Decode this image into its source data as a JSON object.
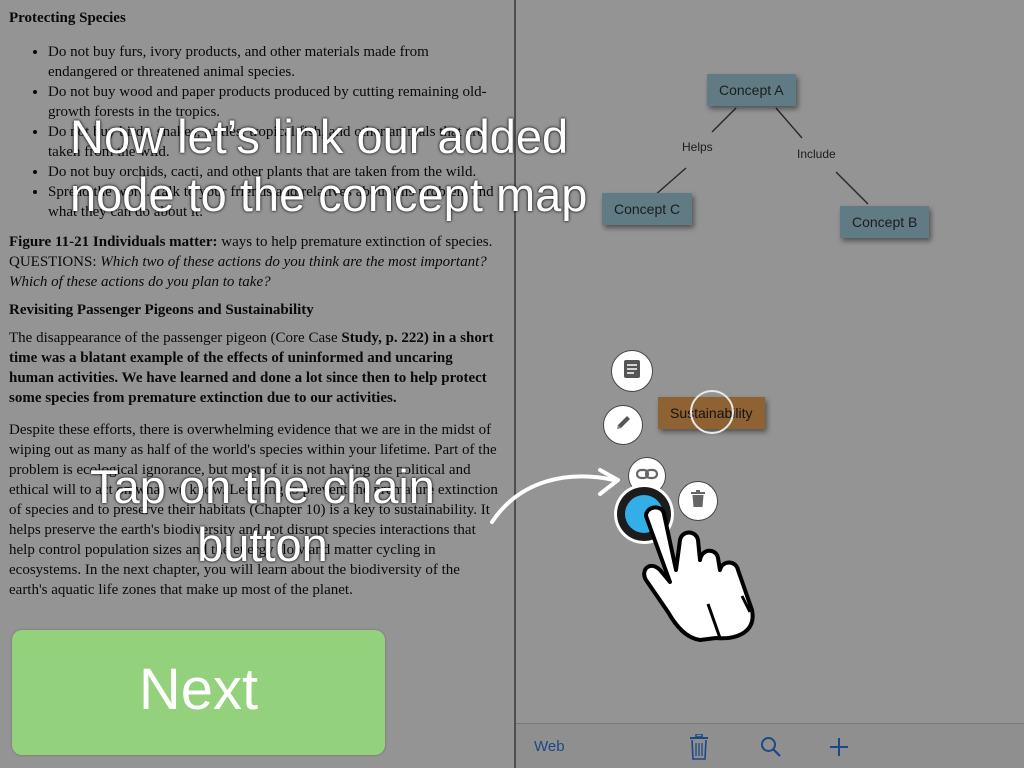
{
  "document": {
    "heading1": "Protecting Species",
    "bullets": [
      "Do not buy furs, ivory products, and other materials made from endangered or threatened animal species.",
      "Do not buy wood and paper products produced by cutting remaining old-growth forests in the tropics.",
      "Do not buy birds, snakes, turtles, tropical fish, and other animals that are taken from the wild.",
      "Do not buy orchids, cacti, and other plants that are taken from the wild.",
      "Spread the word. Talk to your friends and relatives about this problem and what they can do about it."
    ],
    "figure_label": "Figure 11-21 Individuals matter:",
    "figure_text": " ways to help premature extinction of species. QUESTIONS: ",
    "figure_questions": "Which two of these actions do you think are the most important? Which of these actions do you plan to take?",
    "heading2": "Revisiting Passenger Pigeons and Sustainability",
    "para1_start": "The disappearance of the passenger pigeon (Core Case ",
    "para1_bold": "Study, p. 222) in a short time was a blatant example of the effects of uninformed and uncaring human activities. We have learned and done a lot since then to help protect some species from premature extinction due to our activities.",
    "para2": "Despite these efforts, there is overwhelming evidence that we are in the midst of wiping out as many as half of the world's species within your lifetime. Part of the problem is ecological ignorance, but most of it is not having the political and ethical will to act on what we know. Learning to prevent the premature extinction of species and to preserve their habitats (Chapter 10) is a key to sustainability. It helps preserve the earth's biodiversity and not disrupt species interactions that help control population sizes and the energy flow and matter cycling in ecosystems. In the next chapter, you will learn about the biodiversity of the earth's aquatic life zones that make up most of the planet."
  },
  "concept_map": {
    "nodes": [
      {
        "label": "Concept A"
      },
      {
        "label": "Concept C"
      },
      {
        "label": "Concept B"
      },
      {
        "label": "Sustainability"
      }
    ],
    "link_labels": [
      "Helps",
      "Include"
    ],
    "colors": {
      "concept_node": "#a7d4e4",
      "new_node": "#f6a95b"
    }
  },
  "toolbar": {
    "web_label": "Web",
    "icons": [
      "trash-icon",
      "search-icon",
      "plus-icon"
    ],
    "accent": "#2f7ee8"
  },
  "node_actions": {
    "icons": [
      "note-icon",
      "pencil-icon",
      "chain-link-icon",
      "trash-icon"
    ]
  },
  "tutorial": {
    "caption_top_line1": "Now let’s link our added",
    "caption_top_line2": "node to the concept map",
    "caption_tap_line1": "Tap on the chain",
    "caption_tap_line2": "button",
    "next_label": "Next",
    "next_color": "#93d17c"
  }
}
